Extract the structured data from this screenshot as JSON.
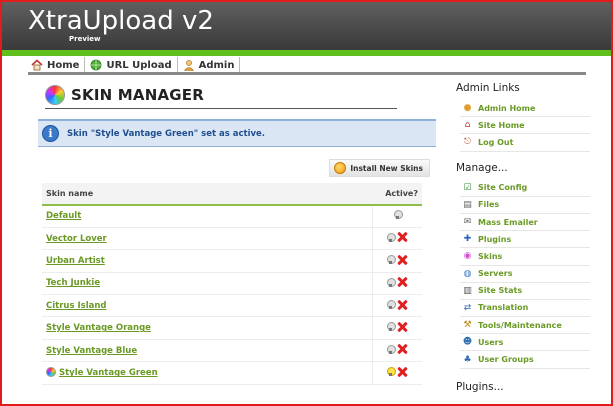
{
  "header": {
    "logo": "XtraUpload v2",
    "logo_sub": "Preview"
  },
  "nav": [
    {
      "label": "Home",
      "icon": "house-icon"
    },
    {
      "label": "URL Upload",
      "icon": "globe-icon"
    },
    {
      "label": "Admin",
      "icon": "user-icon"
    }
  ],
  "main": {
    "title": "SKIN MANAGER",
    "notice": "Skin \"Style Vantage Green\" set as active.",
    "install_label": "Install New Skins",
    "table": {
      "col_name": "Skin name",
      "col_active": "Active?",
      "rows": [
        {
          "name": "Default",
          "active": false,
          "deletable": false
        },
        {
          "name": "Vector Lover",
          "active": false,
          "deletable": true
        },
        {
          "name": "Urban Artist",
          "active": false,
          "deletable": true
        },
        {
          "name": "Tech Junkie",
          "active": false,
          "deletable": true
        },
        {
          "name": "Citrus Island",
          "active": false,
          "deletable": true
        },
        {
          "name": "Style Vantage Orange",
          "active": false,
          "deletable": true
        },
        {
          "name": "Style Vantage Blue",
          "active": false,
          "deletable": true
        },
        {
          "name": "Style Vantage Green",
          "active": true,
          "deletable": true
        }
      ]
    }
  },
  "sidebar": {
    "admin_links_title": "Admin Links",
    "admin_links": [
      {
        "label": "Admin Home",
        "icon": "user-icon"
      },
      {
        "label": "Site Home",
        "icon": "house-icon"
      },
      {
        "label": "Log Out",
        "icon": "logout-icon"
      }
    ],
    "manage_title": "Manage...",
    "manage": [
      {
        "label": "Site Config",
        "icon": "config-icon"
      },
      {
        "label": "Files",
        "icon": "files-icon"
      },
      {
        "label": "Mass Emailer",
        "icon": "email-icon"
      },
      {
        "label": "Plugins",
        "icon": "plugin-icon"
      },
      {
        "label": "Skins",
        "icon": "skins-icon"
      },
      {
        "label": "Servers",
        "icon": "server-icon"
      },
      {
        "label": "Site Stats",
        "icon": "stats-icon"
      },
      {
        "label": "Translation",
        "icon": "translation-icon"
      },
      {
        "label": "Tools/Maintenance",
        "icon": "tools-icon"
      },
      {
        "label": "Users",
        "icon": "users-icon"
      },
      {
        "label": "User Groups",
        "icon": "user-groups-icon"
      }
    ],
    "plugins_title": "Plugins..."
  },
  "colors": {
    "accent_green": "#5fc01d",
    "link_green": "#6a9a25",
    "frame_red": "#e21b1b",
    "notice_bg": "#dbe6f5"
  }
}
